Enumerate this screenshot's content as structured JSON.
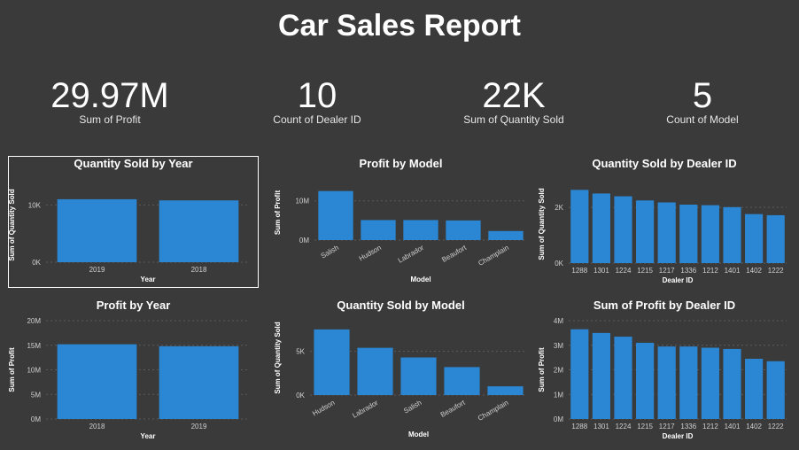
{
  "report": {
    "title": "Car Sales Report"
  },
  "kpis": [
    {
      "value": "29.97M",
      "label": "Sum of Profit"
    },
    {
      "value": "10",
      "label": "Count of Dealer ID"
    },
    {
      "value": "22K",
      "label": "Sum of Quantity Sold"
    },
    {
      "value": "5",
      "label": "Count of Model"
    }
  ],
  "colors": {
    "bar": "#2b86d3",
    "background": "#3a3a3a",
    "grid": "#5a5a5a",
    "text": "#ffffff",
    "tick": "#cfcfcf"
  },
  "chart_data": [
    {
      "id": "qty-by-year",
      "type": "bar",
      "title": "Quantity Sold by Year",
      "xlabel": "Year",
      "ylabel": "Sum of Quantity Sold",
      "categories": [
        "2019",
        "2018"
      ],
      "values": [
        11000,
        10800
      ],
      "ylim": [
        0,
        13000
      ],
      "yticks": [
        0,
        10000
      ],
      "yticklabels": [
        "0K",
        "10K"
      ],
      "grid": true,
      "rotate_labels": false
    },
    {
      "id": "profit-by-model",
      "type": "bar",
      "title": "Profit by Model",
      "xlabel": "Model",
      "ylabel": "Sum of Profit",
      "categories": [
        "Salish",
        "Hudson",
        "Labrador",
        "Beaufort",
        "Champlain"
      ],
      "values": [
        12500000,
        5100000,
        5100000,
        5000000,
        2300000
      ],
      "ylim": [
        0,
        14000000
      ],
      "yticks": [
        0,
        10000000
      ],
      "yticklabels": [
        "0M",
        "10M"
      ],
      "grid": true,
      "rotate_labels": true
    },
    {
      "id": "qty-by-dealer",
      "type": "bar",
      "title": "Quantity Sold by Dealer ID",
      "xlabel": "Dealer ID",
      "ylabel": "Sum of Quantity Sold",
      "categories": [
        "1288",
        "1301",
        "1224",
        "1215",
        "1217",
        "1336",
        "1212",
        "1401",
        "1402",
        "1222"
      ],
      "values": [
        2630,
        2500,
        2400,
        2250,
        2180,
        2100,
        2080,
        2010,
        1760,
        1720
      ],
      "ylim": [
        0,
        2800
      ],
      "yticks": [
        0,
        2000
      ],
      "yticklabels": [
        "0K",
        "2K"
      ],
      "grid": true,
      "rotate_labels": false
    },
    {
      "id": "profit-by-year",
      "type": "bar",
      "title": "Profit by Year",
      "xlabel": "Year",
      "ylabel": "Sum of Profit",
      "categories": [
        "2018",
        "2019"
      ],
      "values": [
        15200000,
        14800000
      ],
      "ylim": [
        0,
        20000000
      ],
      "yticks": [
        0,
        5000000,
        10000000,
        15000000,
        20000000
      ],
      "yticklabels": [
        "0M",
        "5M",
        "10M",
        "15M",
        "20M"
      ],
      "grid": true,
      "rotate_labels": false
    },
    {
      "id": "qty-by-model",
      "type": "bar",
      "title": "Quantity Sold by Model",
      "xlabel": "Model",
      "ylabel": "Sum of Quantity Sold",
      "categories": [
        "Hudson",
        "Labrador",
        "Salish",
        "Beaufort",
        "Champlain"
      ],
      "values": [
        7500,
        5400,
        4300,
        3200,
        1000
      ],
      "ylim": [
        0,
        8500
      ],
      "yticks": [
        0,
        5000
      ],
      "yticklabels": [
        "0K",
        "5K"
      ],
      "grid": true,
      "rotate_labels": true
    },
    {
      "id": "profit-by-dealer",
      "type": "bar",
      "title": "Sum of Profit by Dealer ID",
      "xlabel": "Dealer ID",
      "ylabel": "Sum of Profit",
      "categories": [
        "1288",
        "1301",
        "1224",
        "1215",
        "1217",
        "1336",
        "1212",
        "1401",
        "1402",
        "1222"
      ],
      "values": [
        3650000,
        3500000,
        3350000,
        3100000,
        2950000,
        2950000,
        2900000,
        2850000,
        2450000,
        2350000
      ],
      "ylim": [
        0,
        4000000
      ],
      "yticks": [
        0,
        1000000,
        2000000,
        3000000,
        4000000
      ],
      "yticklabels": [
        "0M",
        "1M",
        "2M",
        "3M",
        "4M"
      ],
      "grid": true,
      "rotate_labels": false
    }
  ]
}
